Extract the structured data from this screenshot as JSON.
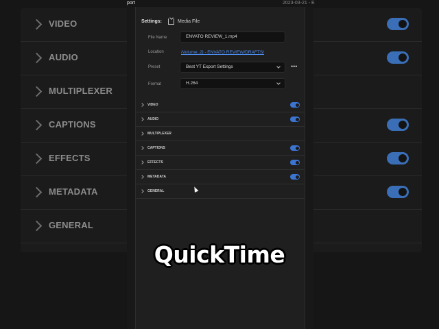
{
  "background": {
    "title_left": "port",
    "title_right": "2023-03-21 - E",
    "rows": [
      {
        "label": "VIDEO",
        "toggle": true
      },
      {
        "label": "AUDIO",
        "toggle": true
      },
      {
        "label": "MULTIPLEXER",
        "toggle": false
      },
      {
        "label": "CAPTIONS",
        "toggle": true
      },
      {
        "label": "EFFECTS",
        "toggle": true
      },
      {
        "label": "METADATA",
        "toggle": true
      },
      {
        "label": "GENERAL",
        "toggle": false
      }
    ]
  },
  "settings": {
    "label": "Settings:",
    "media_label": "Media File",
    "file_name_label": "File Name",
    "file_name_value": "ENVATO REVIEW_1.mp4",
    "location_label": "Location",
    "location_value": "/Volume..2] - ENVATO REVIEW/DRAFTS/",
    "preset_label": "Preset",
    "preset_value": "Best YT Export Settings",
    "more_icon": "more-horizontal-icon",
    "more_glyph": "•••",
    "format_label": "Format",
    "format_value": "H.264"
  },
  "sections": [
    {
      "label": "VIDEO",
      "toggle": true
    },
    {
      "label": "AUDIO",
      "toggle": true
    },
    {
      "label": "MULTIPLEXER",
      "toggle": false
    },
    {
      "label": "CAPTIONS",
      "toggle": true
    },
    {
      "label": "EFFECTS",
      "toggle": true
    },
    {
      "label": "METADATA",
      "toggle": true
    },
    {
      "label": "GENERAL",
      "toggle": false
    }
  ],
  "overlay_caption": "QuickTime",
  "colors": {
    "accent": "#3b74d1",
    "link": "#4d8ef0",
    "panel": "#1f1f1f"
  }
}
